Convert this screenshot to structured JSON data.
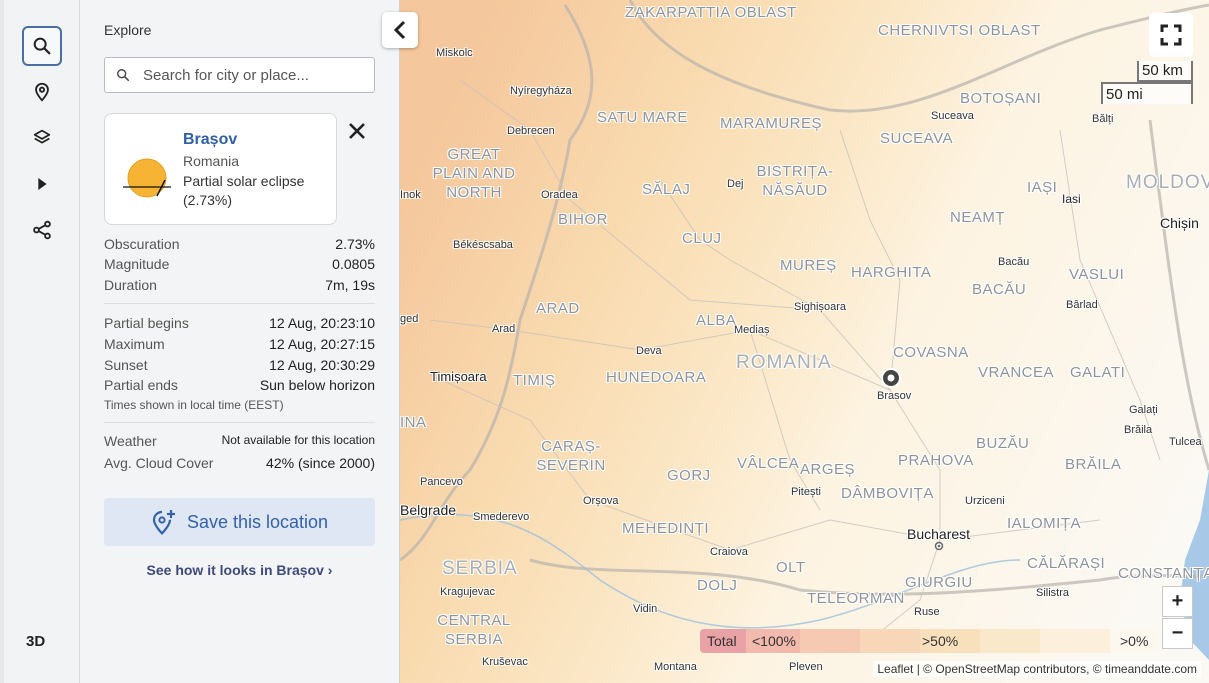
{
  "rail": {
    "three_d": "3D"
  },
  "panel": {
    "explore": "Explore",
    "search_placeholder": "Search for city or place...",
    "card": {
      "city": "Brașov",
      "country": "Romania",
      "eclipse_type": "Partial solar eclipse",
      "eclipse_pct": "(2.73%)"
    },
    "stats": [
      {
        "k": "Obscuration",
        "v": "2.73%"
      },
      {
        "k": "Magnitude",
        "v": "0.0805"
      },
      {
        "k": "Duration",
        "v": "7m, 19s"
      }
    ],
    "times": [
      {
        "k": "Partial begins",
        "v": "12 Aug, 20:23:10"
      },
      {
        "k": "Maximum",
        "v": "12 Aug, 20:27:15"
      },
      {
        "k": "Sunset",
        "v": "12 Aug, 20:30:29"
      },
      {
        "k": "Partial ends",
        "v": "Sun below horizon"
      }
    ],
    "times_note": "Times shown in local time (EEST)",
    "weather": {
      "k": "Weather",
      "v": "Not available for this location"
    },
    "cloud": {
      "k": "Avg. Cloud Cover",
      "v": "42% (since 2000)"
    },
    "save_label": "Save this location",
    "see_link": "See how it looks in Brașov"
  },
  "map": {
    "regions": [
      "ZAKARPATTIA OBLAST",
      "CHERNIVTSI OBLAST",
      "SATU MARE",
      "MARAMUREȘ",
      "BOTOȘANI",
      "SUCEAVA",
      "GREAT PLAIN AND NORTH",
      "SĂLAJ",
      "BISTRIȚA-NĂSĂUD",
      "IAȘI",
      "MOLDOV",
      "BIHOR",
      "CLUJ",
      "NEAMȚ",
      "MUREȘ",
      "HARGHITA",
      "BACĂU",
      "VASLUI",
      "ARAD",
      "ALBA",
      "ROMANIA",
      "COVASNA",
      "TIMIȘ",
      "HUNEDOARA",
      "VRANCEA",
      "GALATI",
      "CARAȘ-SEVERIN",
      "GORJ",
      "VÂLCEA",
      "ARGEȘ",
      "PRAHOVA",
      "BUZĂU",
      "BRĂILA",
      "DÂMBOVIȚA",
      "IALOMIȚA",
      "MEHEDINȚI",
      "CĂLĂRAȘI",
      "OLT",
      "SERBIA",
      "DOLJ",
      "GIURGIU",
      "CONSTANȚA",
      "TELEORMAN",
      "CENTRAL SERBIA",
      "INA"
    ],
    "cities": [
      "Miskolc",
      "Nyíregyháza",
      "Debrecen",
      "Suceava",
      "Bălți",
      "Dej",
      "Oradea",
      "Iasi",
      "Chișin",
      "Inok",
      "Békéscsaba",
      "Bacău",
      "Bârlad",
      "Sighișoara",
      "Arad",
      "Mediaș",
      "ged",
      "Deva",
      "Timișoara",
      "Brasov",
      "Galați",
      "Brăila",
      "Tulcea",
      "Pancevo",
      "Orșova",
      "Pitești",
      "Urziceni",
      "Belgrade",
      "Smederevo",
      "Bucharest",
      "Craiova",
      "Kragujevac",
      "Vidin",
      "Ruse",
      "Silistra",
      "Kruševac",
      "Montana",
      "Pleven"
    ],
    "scale_km": "50 km",
    "scale_mi": "50 mi",
    "zoom_in": "+",
    "zoom_out": "−",
    "legend": [
      "Total",
      "<100%",
      ">50%",
      ">0%"
    ],
    "attribution": "Leaflet | © OpenStreetMap contributors, © timeanddate.com"
  }
}
